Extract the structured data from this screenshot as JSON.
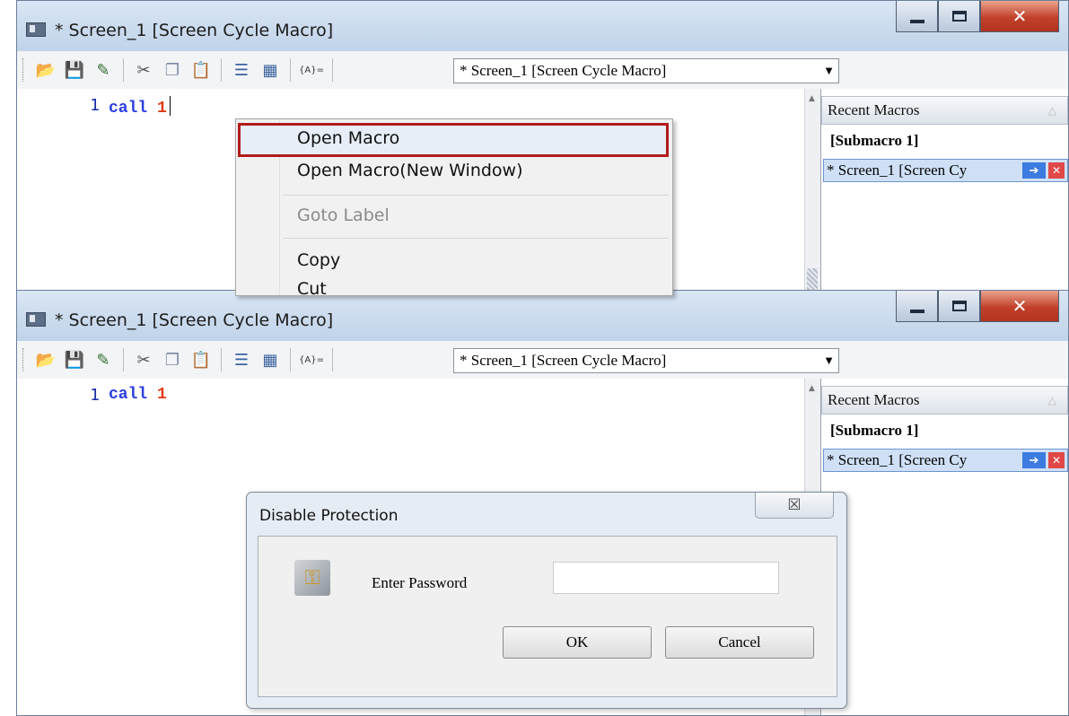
{
  "top_window": {
    "title": "* Screen_1 [Screen Cycle Macro]",
    "combo_value": "* Screen_1 [Screen Cycle Macro]",
    "code": {
      "line_number": "1",
      "keyword": "call",
      "argument": "1"
    },
    "recent_macros": {
      "header": "Recent Macros",
      "items": [
        "[Submacro 1]",
        "* Screen_1 [Screen Cy"
      ]
    },
    "context_menu": {
      "items": [
        {
          "label": "Open Macro",
          "enabled": true,
          "highlighted": true
        },
        {
          "label": "Open Macro(New Window)",
          "enabled": true
        },
        {
          "label": "Goto Label",
          "enabled": false
        },
        {
          "label": "Copy",
          "enabled": true
        },
        {
          "label": "Cut",
          "enabled": true
        }
      ]
    }
  },
  "bottom_window": {
    "title": "* Screen_1 [Screen Cycle Macro]",
    "combo_value": "* Screen_1 [Screen Cycle Macro]",
    "code": {
      "line_number": "1",
      "keyword": "call",
      "argument": "1"
    },
    "recent_macros": {
      "header": "Recent Macros",
      "items": [
        "[Submacro 1]",
        "* Screen_1 [Screen Cy"
      ]
    }
  },
  "toolbar": {
    "icons": [
      "open-folder-icon",
      "save-icon",
      "edit-icon",
      "cut-icon",
      "copy-icon",
      "paste-icon",
      "list-icon",
      "properties-icon",
      "variable-icon"
    ],
    "variable_label": "{A}="
  },
  "dialog": {
    "title": "Disable Protection",
    "close_glyph": "☒",
    "password_label": "Enter Password",
    "password_value": "",
    "ok_label": "OK",
    "cancel_label": "Cancel"
  },
  "colors": {
    "keyword": "#2a3ee0",
    "number": "#e03a16",
    "highlight_border": "#b11b1b",
    "close_button": "#c2402a"
  }
}
